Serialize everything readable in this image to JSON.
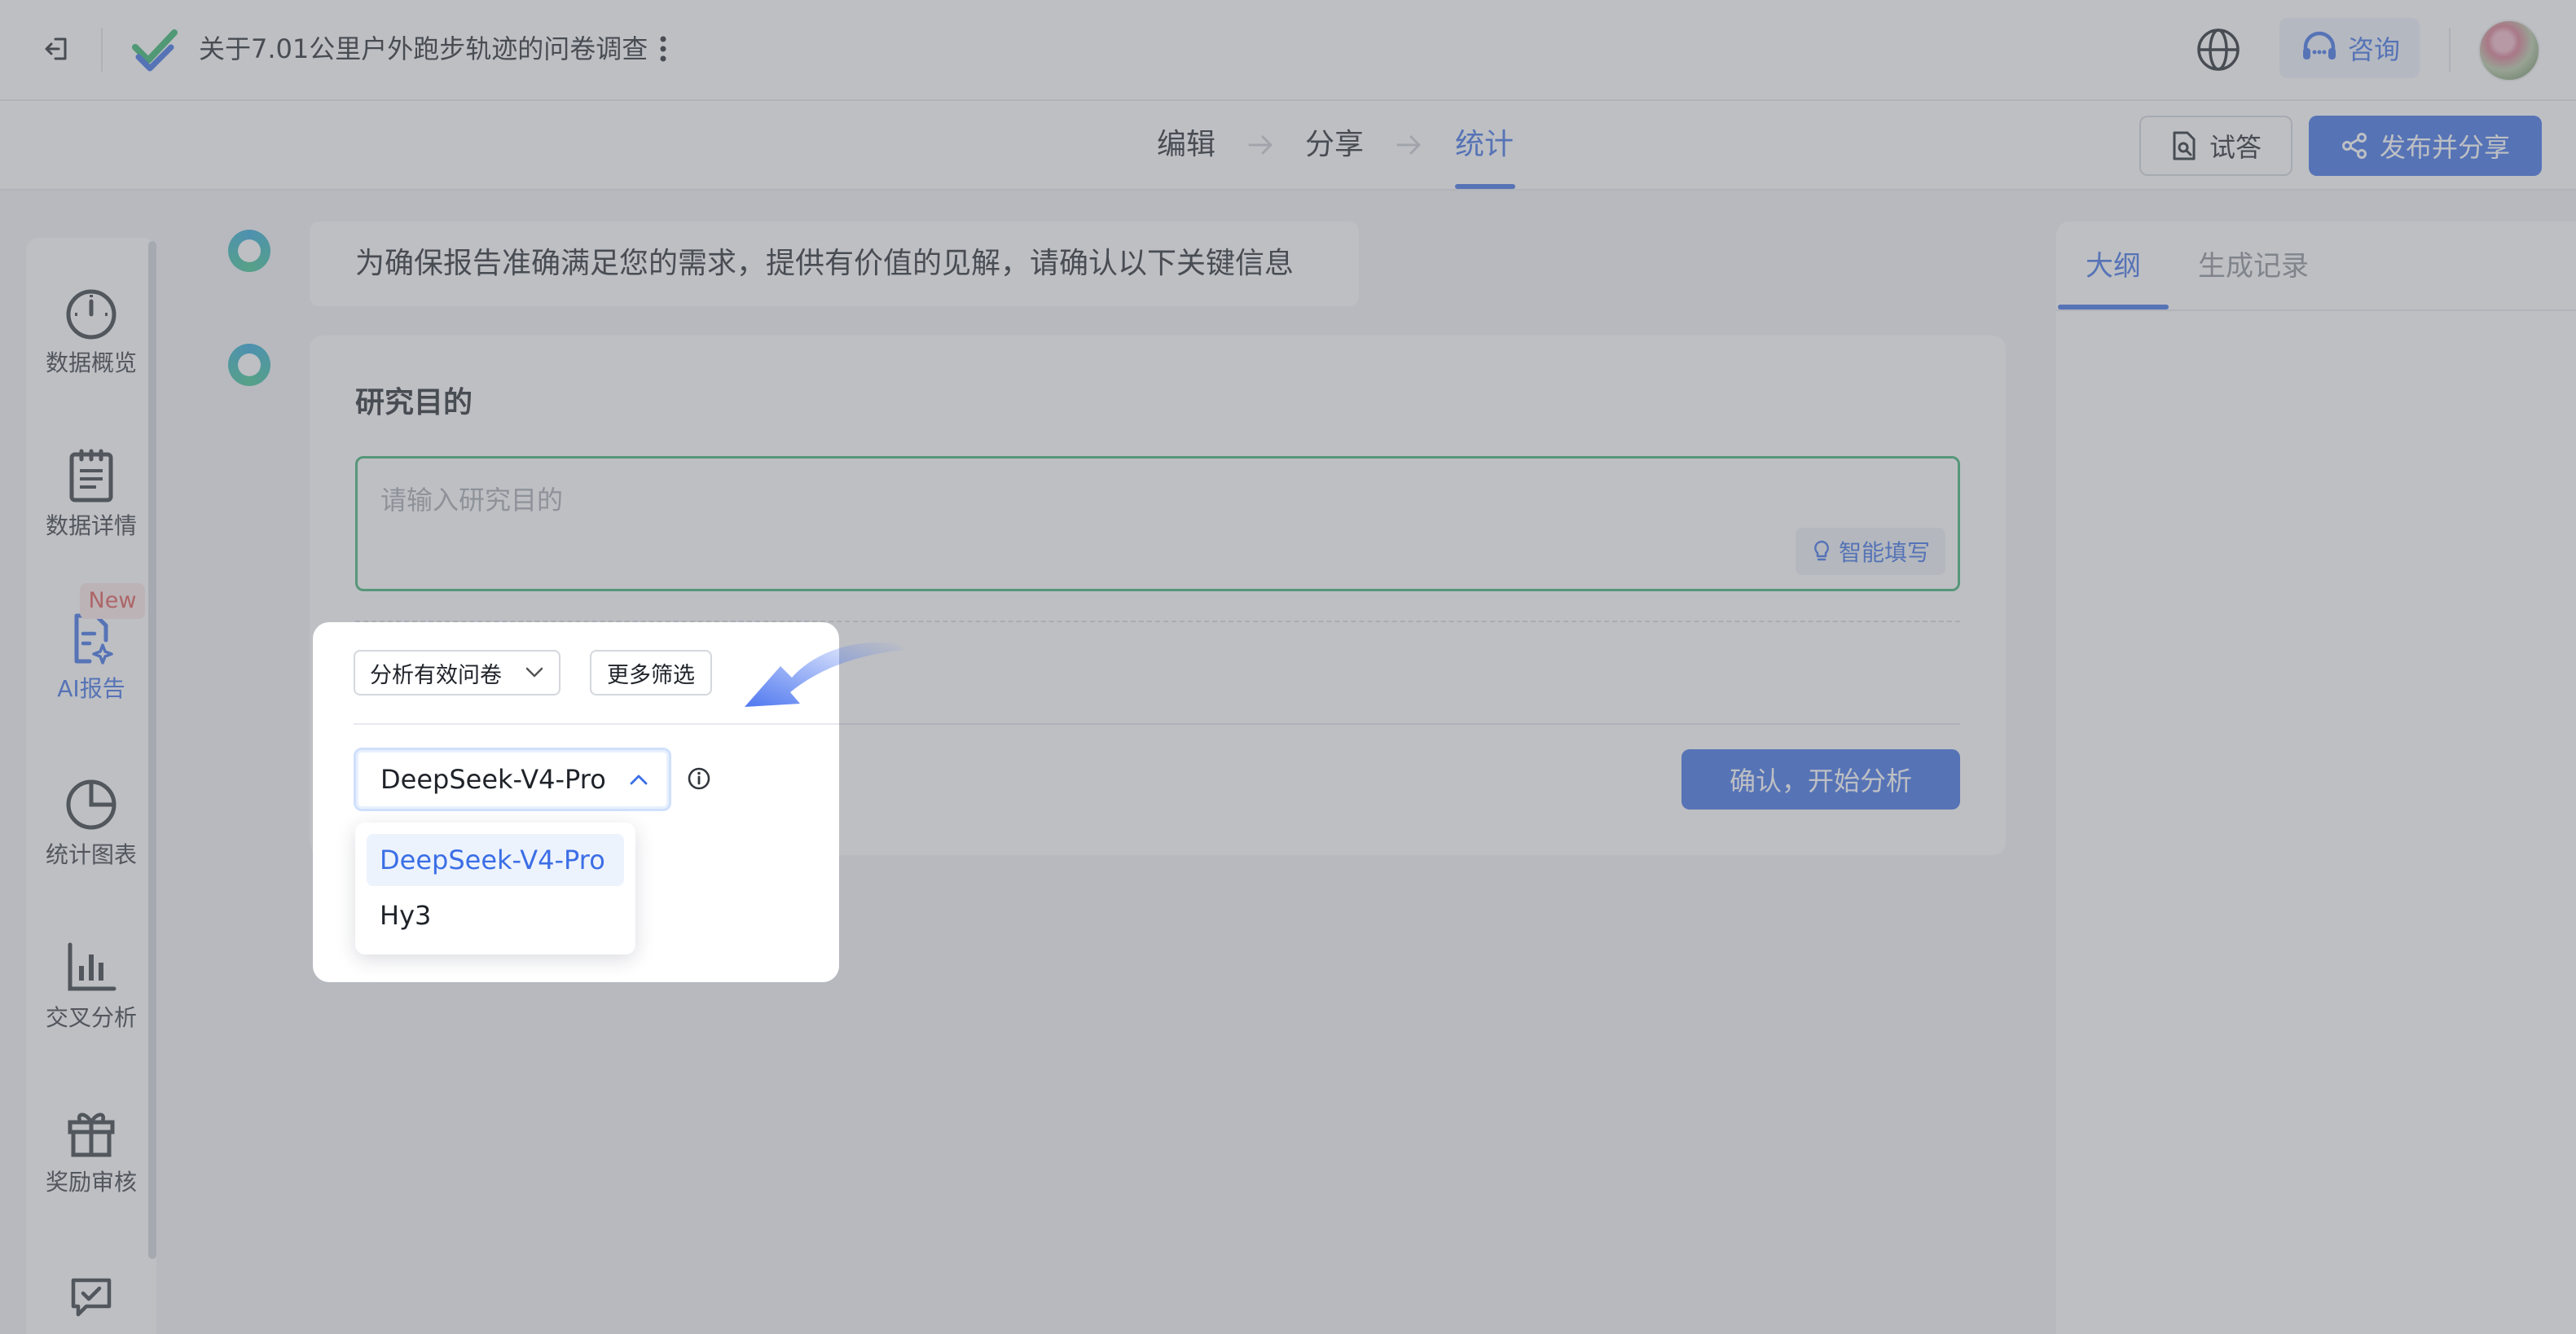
{
  "header": {
    "survey_title": "关于7.01公里户外跑步轨迹的问卷调查",
    "consult_label": "咨询",
    "icons": [
      "exit-icon",
      "app-logo",
      "more-vert-icon",
      "globe-icon",
      "headset-icon",
      "avatar"
    ]
  },
  "steps": {
    "items": [
      {
        "label": "编辑",
        "active": false
      },
      {
        "label": "分享",
        "active": false
      },
      {
        "label": "统计",
        "active": true
      }
    ],
    "trial_label": "试答",
    "publish_label": "发布并分享"
  },
  "sidebar": {
    "items": [
      {
        "label": "数据概览",
        "icon": "dashboard-icon",
        "active": false
      },
      {
        "label": "数据详情",
        "icon": "clipboard-icon",
        "active": false
      },
      {
        "label": "AI报告",
        "icon": "ai-report-icon",
        "active": true,
        "badge": "New"
      },
      {
        "label": "统计图表",
        "icon": "pie-chart-icon",
        "active": false
      },
      {
        "label": "交叉分析",
        "icon": "bar-chart-icon",
        "active": false
      },
      {
        "label": "奖励审核",
        "icon": "gift-icon",
        "active": false
      }
    ]
  },
  "main": {
    "notice": "为确保报告准确满足您的需求，提供有价值的见解，请确认以下关键信息",
    "purpose_title": "研究目的",
    "purpose_placeholder": "请输入研究目的",
    "smart_fill_label": "智能填写",
    "confirm_label": "确认，开始分析"
  },
  "popup": {
    "filter_value": "分析有效问卷",
    "more_filter_label": "更多筛选",
    "model_value": "DeepSeek-V4-Pro",
    "model_options": [
      "DeepSeek-V4-Pro",
      "Hy3"
    ]
  },
  "right_panel": {
    "tabs": [
      {
        "label": "大纲",
        "active": true
      },
      {
        "label": "生成记录",
        "active": false
      }
    ]
  },
  "colors": {
    "accent": "#3b6ee6",
    "input_border": "#3bb372",
    "badge_text": "#e0534f",
    "overlay": "#767982"
  }
}
